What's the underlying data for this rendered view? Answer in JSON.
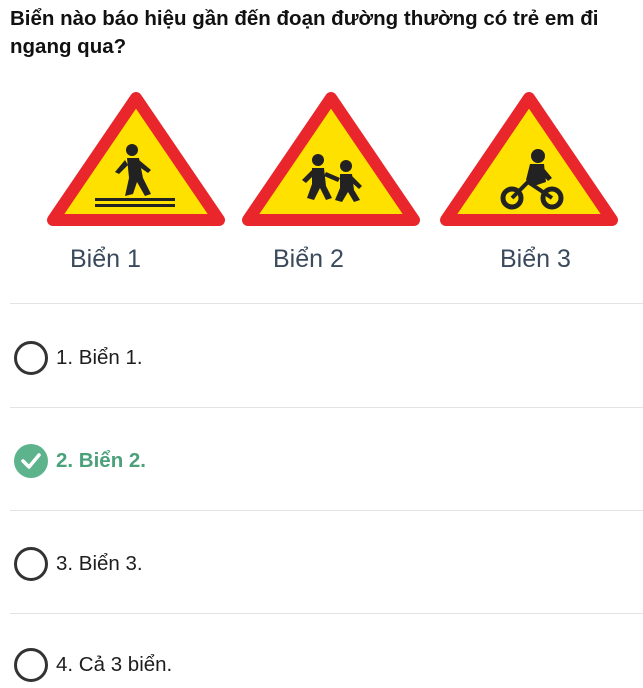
{
  "question": "Biển nào báo hiệu gần đến đoạn đường thường có trẻ em đi ngang qua?",
  "signs": [
    {
      "label": "Biển 1",
      "depicts": "pedestrian-crossing"
    },
    {
      "label": "Biển 2",
      "depicts": "children-crossing"
    },
    {
      "label": "Biển 3",
      "depicts": "cyclist"
    }
  ],
  "options": [
    {
      "text": "1. Biển 1.",
      "selected": false,
      "correct": false
    },
    {
      "text": "2. Biển 2.",
      "selected": true,
      "correct": true
    },
    {
      "text": "3. Biển 3.",
      "selected": false,
      "correct": false
    },
    {
      "text": "4. Cả 3 biển.",
      "selected": false,
      "correct": false
    }
  ],
  "colors": {
    "sign_border": "#e8262b",
    "sign_fill": "#ffe100",
    "correct": "#5cb38c",
    "label": "#3a4a5c"
  }
}
